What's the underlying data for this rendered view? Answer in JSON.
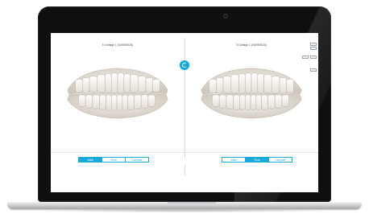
{
  "app": {
    "panes": [
      {
        "title": "Tx Design 1 (04/09/2020)",
        "view_mode": "Initial"
      },
      {
        "title": "Tx Design 1 (04/09/2020)",
        "view_mode": "Final"
      }
    ],
    "segment_options": [
      "Initial",
      "Final",
      "Compare"
    ],
    "center_label": "",
    "view_controls": {
      "top": "",
      "bottom": ""
    },
    "zoom": {
      "plus": "+",
      "minus": "−"
    },
    "accent_color": "#17a8dc"
  },
  "icons": {
    "sync": "sync-icon",
    "camera": "camera-icon"
  }
}
